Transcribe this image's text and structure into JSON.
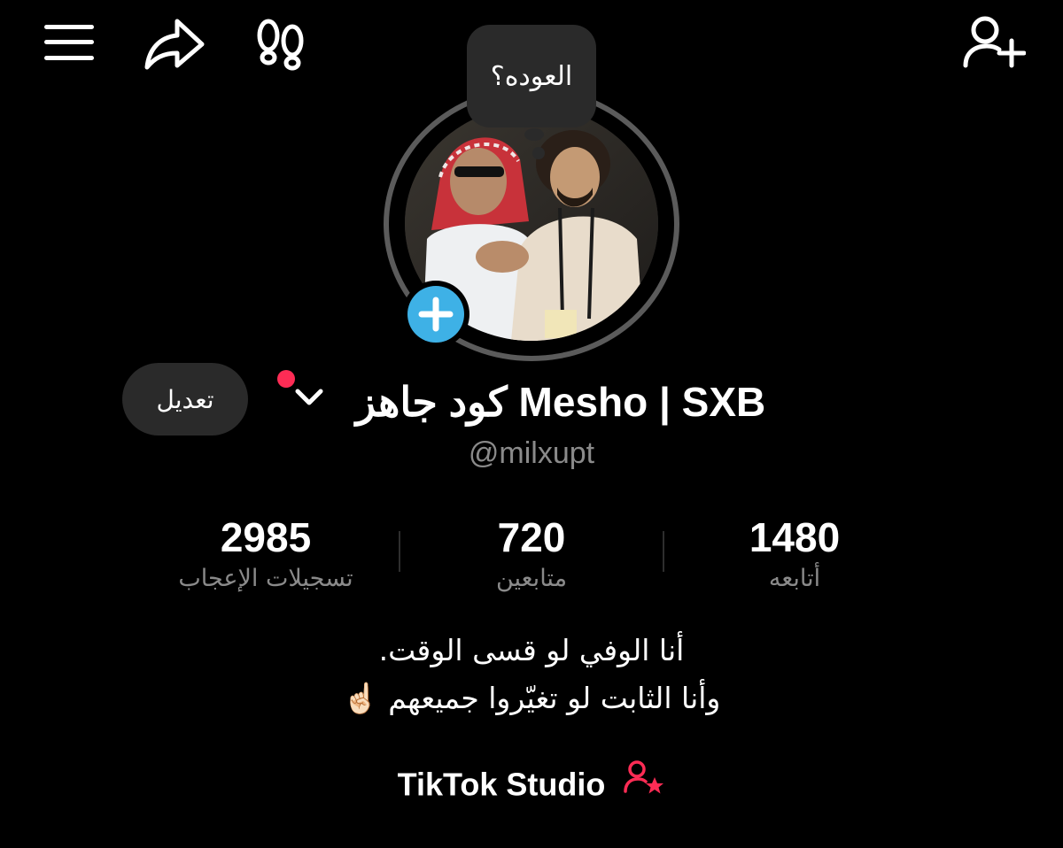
{
  "topbar": {
    "menu_icon": "hamburger-menu-icon",
    "share_icon": "share-arrow-icon",
    "footprints_icon": "footprints-icon",
    "add_friend_icon": "add-user-icon"
  },
  "note": {
    "text": "العوده؟"
  },
  "avatar": {
    "badge_icon": "plus-icon",
    "badge_color": "#3eb1e6"
  },
  "profile": {
    "display_name": "كود جاهز Mesho | SXB",
    "username": "@milxupt",
    "edit_label": "تعديل",
    "notification_dot_color": "#fe2c55"
  },
  "stats": [
    {
      "value": "2985",
      "label": "تسجيلات الإعجاب"
    },
    {
      "value": "720",
      "label": "متابعين"
    },
    {
      "value": "1480",
      "label": "أتابعه"
    }
  ],
  "bio": {
    "line1": "أنا الوفي لو قسى الوقت.",
    "line2": "وأنا الثابت لو تغيّروا جميعهم ☝🏻"
  },
  "studio": {
    "label": "TikTok Studio",
    "icon": "creator-star-icon",
    "icon_color": "#fe2c55"
  }
}
